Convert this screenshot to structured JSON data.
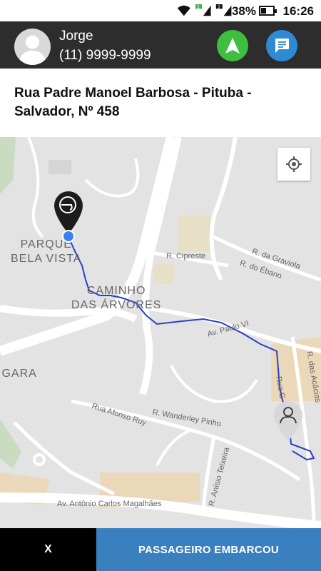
{
  "status_bar": {
    "battery_percent": "38%",
    "time": "16:26",
    "sim1": "1",
    "sim2": "2",
    "icons": [
      "wifi-icon",
      "signal-icon",
      "signal-icon",
      "battery-icon"
    ]
  },
  "driver": {
    "name": "Jorge",
    "phone": "(11) 9999-9999",
    "avatar_icon": "person-icon"
  },
  "actions": {
    "navigate_icon": "navigation-arrow-icon",
    "chat_icon": "chat-message-icon"
  },
  "address": "Rua Padre Manoel Barbosa - Pituba - Salvador, Nº 458",
  "map": {
    "areas": [
      "PARQUE\nBELA VISTA",
      "CAMINHO\nDAS ÁRVORES",
      "IGARA"
    ],
    "streets": [
      "R. Cipreste",
      "R. da Graviola",
      "R. do Ébano",
      "Av. Paulo VI",
      "R. das Acácias",
      "Rua Afonso Ruy",
      "R. Wanderley Pinho",
      "R. Anísio Teixeira",
      "Av. Antônio Carlos Magalhães",
      "Rua G"
    ],
    "route_color": "#2a3fc9",
    "origin_icon": "driver-helmet-pin-icon",
    "destination_icon": "passenger-pin-icon",
    "locate_icon": "my-location-icon"
  },
  "buttons": {
    "cancel": "X",
    "boarded": "PASSAGEIRO EMBARCOU"
  },
  "colors": {
    "header_bg": "#2d2d2d",
    "nav_green": "#3fbf3f",
    "chat_blue": "#2e8bd3",
    "embark_blue": "#3a7fbe"
  }
}
